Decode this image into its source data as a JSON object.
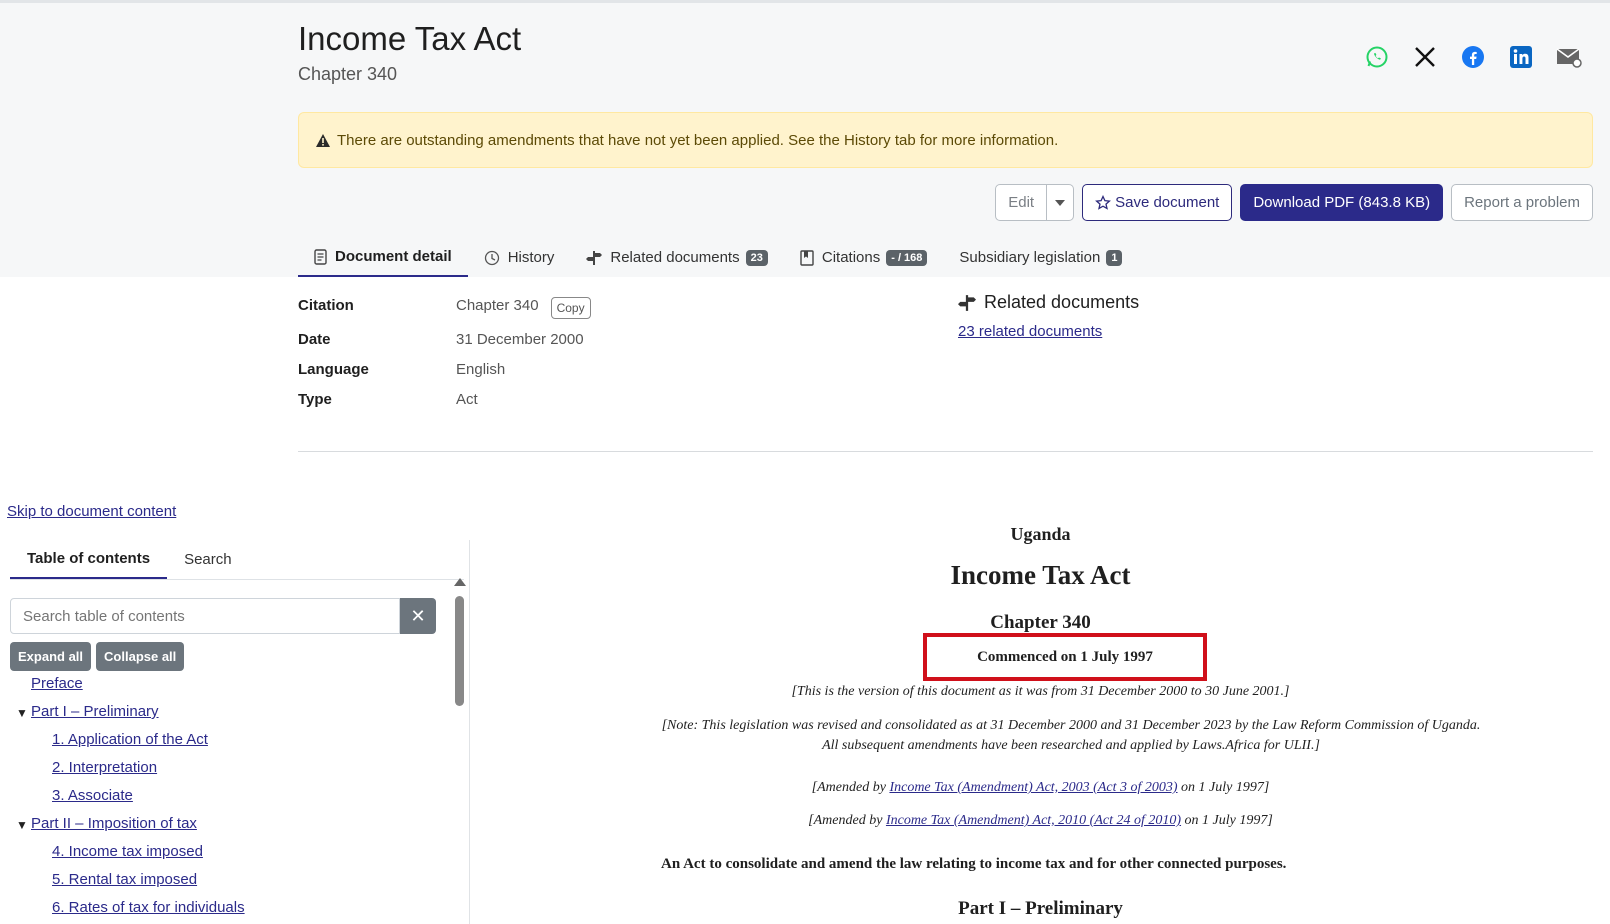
{
  "header": {
    "title": "Income Tax Act",
    "subtitle": "Chapter 340"
  },
  "share": {
    "icons": [
      "whatsapp-icon",
      "x-icon",
      "facebook-icon",
      "linkedin-icon",
      "email-icon"
    ],
    "colors": {
      "whatsapp": "#25d366",
      "x": "#111111",
      "facebook": "#1877f2",
      "linkedin": "#0a66c2",
      "email": "#555555"
    }
  },
  "alert": {
    "text": "There are outstanding amendments that have not yet been applied. See the History tab for more information."
  },
  "actions": {
    "edit": "Edit",
    "save": "Save document",
    "download": "Download PDF (843.8 KB)",
    "report": "Report a problem"
  },
  "tabs": [
    {
      "label": "Document detail",
      "badge": null
    },
    {
      "label": "History",
      "badge": null
    },
    {
      "label": "Related documents",
      "badge": "23"
    },
    {
      "label": "Citations",
      "badge": "- / 168"
    },
    {
      "label": "Subsidiary legislation",
      "badge": "1"
    }
  ],
  "detail": {
    "citation_label": "Citation",
    "citation_value": "Chapter 340",
    "copy": "Copy",
    "date_label": "Date",
    "date_value": "31 December 2000",
    "language_label": "Language",
    "language_value": "English",
    "type_label": "Type",
    "type_value": "Act",
    "related_title": "Related documents",
    "related_link": "23 related documents"
  },
  "skip_link": "Skip to document content",
  "toc": {
    "tab_toc": "Table of contents",
    "tab_search": "Search",
    "search_placeholder": "Search table of contents",
    "expand_all": "Expand all",
    "collapse_all": "Collapse all",
    "items": [
      "Preface",
      "Part I – Preliminary",
      "1. Application of the Act",
      "2. Interpretation",
      "3. Associate",
      "Part II – Imposition of tax",
      "4. Income tax imposed",
      "5. Rental tax imposed",
      "6. Rates of tax for individuals"
    ]
  },
  "document": {
    "country": "Uganda",
    "title": "Income Tax Act",
    "chapter": "Chapter 340",
    "commenced": "Commenced on 1 July 1997",
    "version_note": "[This is the version of this document as it was from 31 December 2000 to 30 June 2001.]",
    "revision_note": "[Note: This legislation was revised and consolidated as at 31 December 2000 and 31 December 2023 by the Law Reform Commission of Uganda. All subsequent amendments have been researched and applied by Laws.Africa for ULII.]",
    "amended_prefix": "[Amended by",
    "amend1_link": "Income Tax (Amendment) Act, 2003 (Act 3 of 2003)",
    "amend2_link": "Income Tax (Amendment) Act, 2010 (Act 24 of 2010)",
    "amended_suffix": "on 1 July 1997]",
    "long_title": "An Act to consolidate and amend the law relating to income tax and for other connected purposes.",
    "part_heading": "Part I – Preliminary"
  },
  "colors": {
    "primary": "#2b2a8a",
    "alert_bg": "#fff3cd",
    "highlight": "#d0101a"
  }
}
